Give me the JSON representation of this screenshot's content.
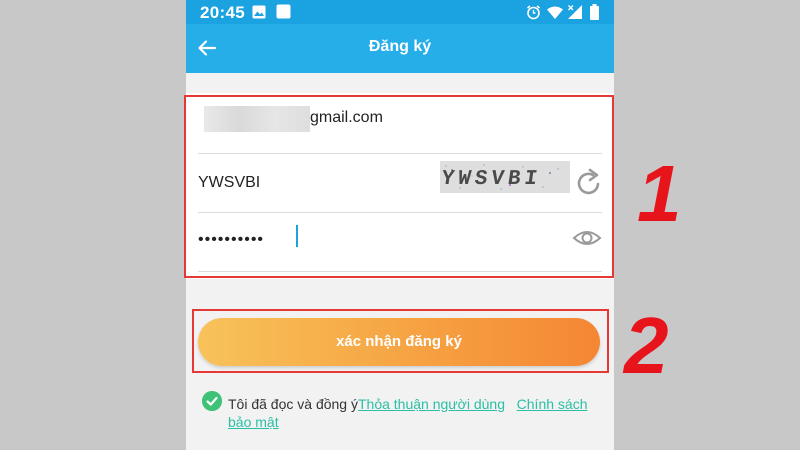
{
  "status_bar": {
    "time": "20:45",
    "icons": [
      "image-icon",
      "notification-square-icon",
      "alarm-icon",
      "wifi-icon",
      "signal-icon",
      "battery-icon"
    ]
  },
  "app_bar": {
    "title": "Đăng ký",
    "back_icon": "arrow-left-icon"
  },
  "form": {
    "email_value": "gmail.com",
    "captcha_value": "YWSVBI",
    "captcha_image_text": "YWSVBI",
    "password_value": "••••••••••",
    "refresh_icon": "refresh-icon",
    "show_password_icon": "eye-icon"
  },
  "submit_button": {
    "label": "xác nhận đăng ký"
  },
  "terms": {
    "prefix": "Tôi đã đọc và đồng ý",
    "link1": "Thỏa thuận người dùng",
    "link2": "Chính sách bảo mật"
  },
  "annotations": {
    "step1": "1",
    "step2": "2"
  },
  "colors": {
    "statusbar": "#1ba2e0",
    "appbar": "#26aee8",
    "button_start": "#f8c25a",
    "button_end": "#f58634",
    "link": "#2bbfa5",
    "check": "#3ec277",
    "annotation": "#e8141c"
  }
}
